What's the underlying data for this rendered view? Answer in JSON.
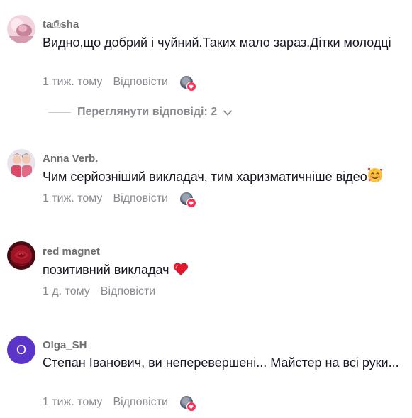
{
  "comments": [
    {
      "username": "ta⎙sha",
      "text": "Видно,що добрий і чуйний.Таких мало зараз.Дітки молодці",
      "time": "1 тиж. тому",
      "reply": "Відповісти",
      "avatar_icon": "avatar-photo-pink",
      "creator_liked": true
    },
    {
      "username": "Anna Verb.",
      "text": "Чим серйозніший викладач, тим харизматичніше відео",
      "emoji": "smiling-face-with-hearts",
      "time": "1 тиж. тому",
      "reply": "Відповісти",
      "avatar_icon": "avatar-photo-kids",
      "creator_liked": true
    },
    {
      "username": "red magnet",
      "text": "позитивний викладач",
      "emoji": "red-heart",
      "time": "1 д. тому",
      "reply": "Відповісти",
      "avatar_icon": "avatar-photo-rose",
      "creator_liked": false
    },
    {
      "username": "Olga_SH",
      "text": "Степан Іванович, ви неперевершені... Майстер на всі руки...",
      "time": "1 тиж. тому",
      "reply": "Відповісти",
      "avatar_letter": "O",
      "avatar_color": "#5b35c9",
      "creator_liked": true
    }
  ],
  "view_replies": {
    "label": "Переглянути відповіді: 2",
    "icon": "chevron-down-icon"
  },
  "colors": {
    "username": "#6f6f6f",
    "text": "#161823",
    "meta": "#8a8b91",
    "like_badge": "#fe2c55"
  }
}
